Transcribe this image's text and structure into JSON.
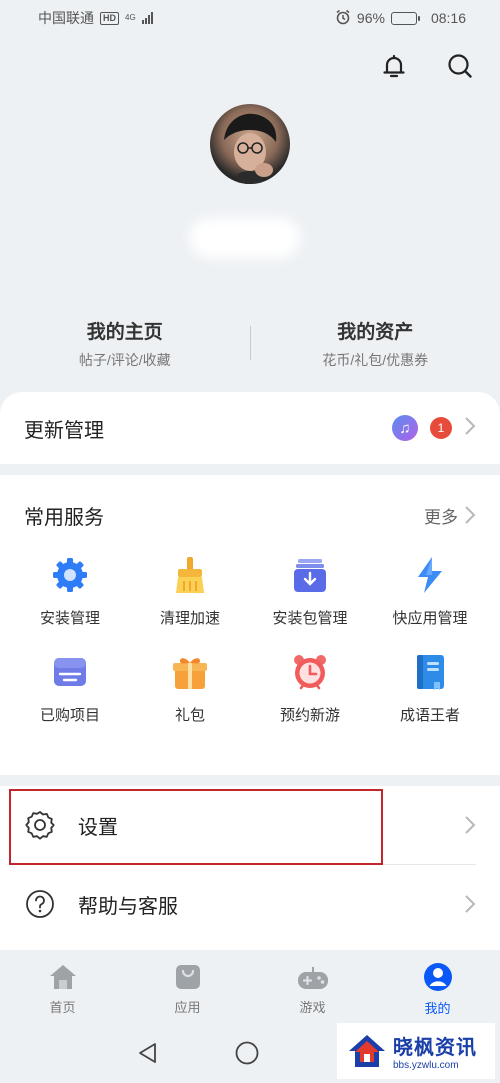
{
  "status_bar": {
    "carrier": "中国联通",
    "hd_badge": "HD",
    "network": "4G",
    "battery_text": "96%",
    "battery_level": 0.96,
    "time": "08:16"
  },
  "header": {
    "icons": [
      "bell-icon",
      "search-icon"
    ]
  },
  "profile": {
    "username": ""
  },
  "entries": [
    {
      "title": "我的主页",
      "subtitle": "帖子/评论/收藏"
    },
    {
      "title": "我的资产",
      "subtitle": "花币/礼包/优惠券"
    }
  ],
  "update": {
    "title": "更新管理",
    "badge_count": "1"
  },
  "services": {
    "title": "常用服务",
    "more_label": "更多",
    "items": [
      {
        "label": "安装管理",
        "icon": "gear-icon"
      },
      {
        "label": "清理加速",
        "icon": "broom-icon"
      },
      {
        "label": "安装包管理",
        "icon": "package-icon"
      },
      {
        "label": "快应用管理",
        "icon": "lightning-icon"
      },
      {
        "label": "已购项目",
        "icon": "purchased-icon"
      },
      {
        "label": "礼包",
        "icon": "gift-icon"
      },
      {
        "label": "预约新游",
        "icon": "alarm-clock-icon"
      },
      {
        "label": "成语王者",
        "icon": "book-icon"
      }
    ]
  },
  "settings": {
    "items": [
      {
        "label": "设置",
        "icon": "gear-outline-icon"
      },
      {
        "label": "帮助与客服",
        "icon": "help-icon"
      }
    ]
  },
  "bottom_nav": {
    "items": [
      {
        "label": "首页",
        "icon": "home-icon"
      },
      {
        "label": "应用",
        "icon": "app-bag-icon"
      },
      {
        "label": "游戏",
        "icon": "gamepad-icon"
      },
      {
        "label": "我的",
        "icon": "profile-icon",
        "active": true
      }
    ]
  },
  "watermark": {
    "title": "晓枫资讯",
    "url": "bbs.yzwlu.com"
  },
  "colors": {
    "accent": "#0a59f7",
    "badge_red": "#e64b3c",
    "highlight_border": "#c0262b",
    "page_bg": "#eef1f4"
  }
}
